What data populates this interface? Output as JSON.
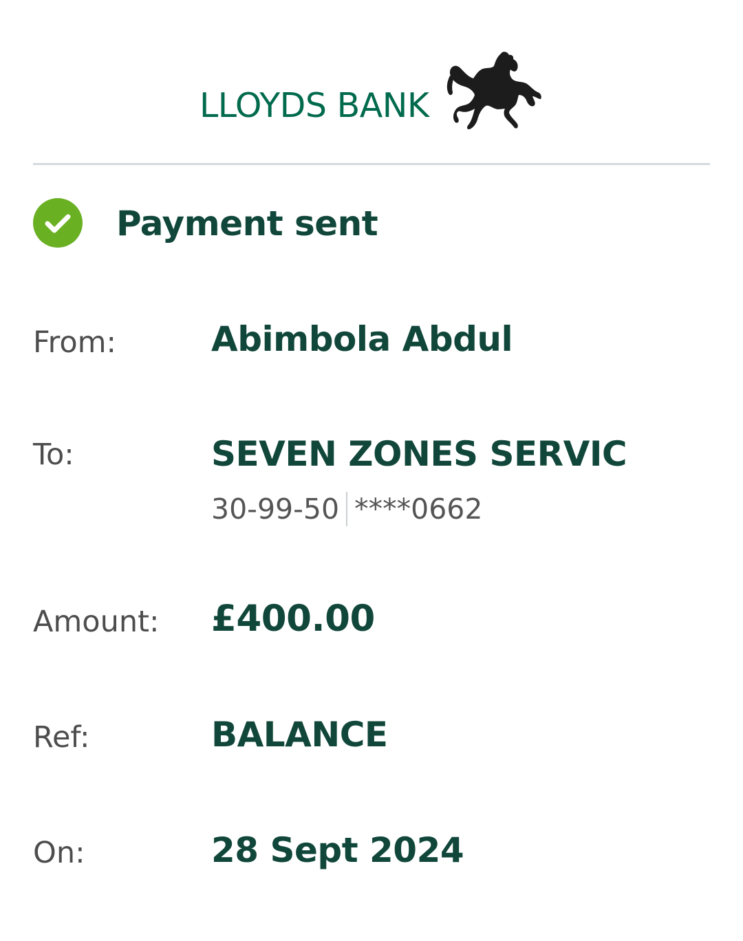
{
  "header": {
    "brand_name": "LLOYDS BANK",
    "logo_icon": "black-horse-icon"
  },
  "status": {
    "icon": "check-circle-icon",
    "text": "Payment sent",
    "color": "#6ab023"
  },
  "details": {
    "from": {
      "label": "From:",
      "value": "Abimbola Abdul"
    },
    "to": {
      "label": "To:",
      "value": "SEVEN ZONES SERVIC",
      "sort_code": "30-99-50",
      "account_number": "****0662"
    },
    "amount": {
      "label": "Amount:",
      "value": "£400.00"
    },
    "ref": {
      "label": "Ref:",
      "value": "BALANCE"
    },
    "on": {
      "label": "On:",
      "value": "28 Sept 2024"
    }
  },
  "colors": {
    "brand_green": "#006a4d",
    "value_green": "#11473a",
    "success_green": "#6ab023"
  }
}
